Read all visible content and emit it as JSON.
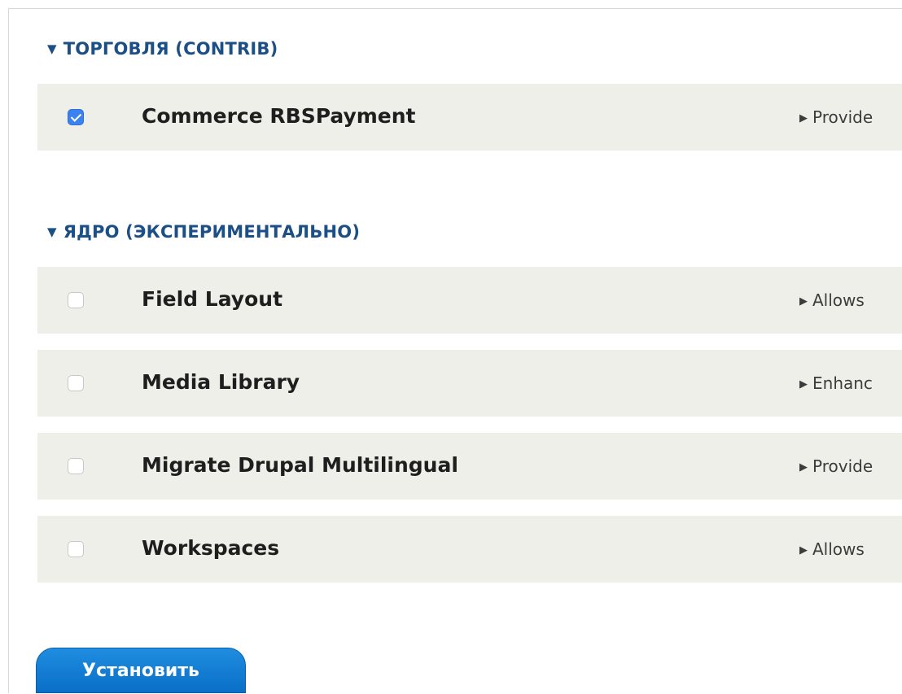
{
  "sections": [
    {
      "title": "ТОРГОВЛЯ (CONTRIB)",
      "modules": [
        {
          "name": "Commerce RBSPayment",
          "description": "Provide",
          "checked": true
        }
      ]
    },
    {
      "title": "ЯДРО (ЭКСПЕРИМЕНТАЛЬНО)",
      "modules": [
        {
          "name": "Field Layout",
          "description": "Allows",
          "checked": false
        },
        {
          "name": "Media Library",
          "description": "Enhanc",
          "checked": false
        },
        {
          "name": "Migrate Drupal Multilingual",
          "description": "Provide",
          "checked": false
        },
        {
          "name": "Workspaces",
          "description": "Allows",
          "checked": false
        }
      ]
    }
  ],
  "icons": {
    "section_toggle": "triangle-down-icon",
    "description_toggle": "triangle-right-icon"
  },
  "colors": {
    "section_title": "#1c4f86",
    "row_background": "#efefea",
    "checkbox_checked": "#3b82f0",
    "button": "#0a6fc7"
  },
  "install_button_label": "Установить"
}
